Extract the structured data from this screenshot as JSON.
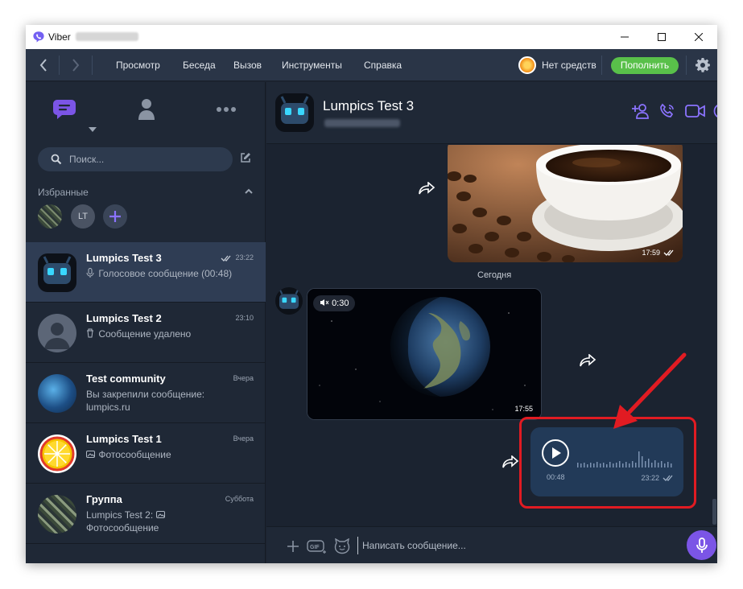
{
  "window": {
    "app_title": "Viber",
    "controls": [
      "minimize",
      "maximize",
      "close"
    ]
  },
  "menubar": {
    "items": [
      "Просмотр",
      "Беседа",
      "Вызов",
      "Инструменты",
      "Справка"
    ],
    "balance": "Нет средств",
    "topup_label": "Пополнить"
  },
  "sidebar": {
    "tabs": [
      "chats-icon",
      "contacts-icon",
      "more-icon"
    ],
    "search_placeholder": "Поиск...",
    "favorites_title": "Избранные",
    "favorites": [
      {
        "initials": "LT"
      }
    ],
    "chats": [
      {
        "name": "Lumpics Test 3",
        "time": "23:22",
        "preview": "Голосовое сообщение (00:48)",
        "preview_icon": "mic-icon",
        "read": true,
        "active": true
      },
      {
        "name": "Lumpics Test 2",
        "time": "23:10",
        "preview": "Сообщение удалено",
        "preview_icon": "trash-icon"
      },
      {
        "name": "Test community",
        "time": "Вчера",
        "preview": "Вы закрепили сообщение: lumpics.ru"
      },
      {
        "name": "Lumpics Test 1",
        "time": "Вчера",
        "preview": "Фотосообщение",
        "preview_icon": "photo-icon"
      },
      {
        "name": "Группа",
        "time": "Суббота",
        "preview_sender": "Lumpics Test 2:",
        "preview": "Фотосообщение",
        "preview_icon": "photo-icon"
      }
    ]
  },
  "chat": {
    "contact_name": "Lumpics Test 3",
    "header_icons": [
      "add-participant-icon",
      "call-icon",
      "video-call-icon",
      "info-icon"
    ],
    "messages": {
      "photo_time": "17:59",
      "date_divider": "Сегодня",
      "video_duration": "0:30",
      "video_time": "17:55",
      "voice_duration": "00:48",
      "voice_time": "23:22"
    },
    "composer_placeholder": "Написать сообщение...",
    "composer_icons": [
      "plus-icon",
      "gif-icon",
      "sticker-icon",
      "microphone-icon"
    ]
  },
  "colors": {
    "accent": "#7b55e6",
    "topup": "#59c04a",
    "highlight": "#e11b22",
    "voice_bubble": "#223a58"
  }
}
